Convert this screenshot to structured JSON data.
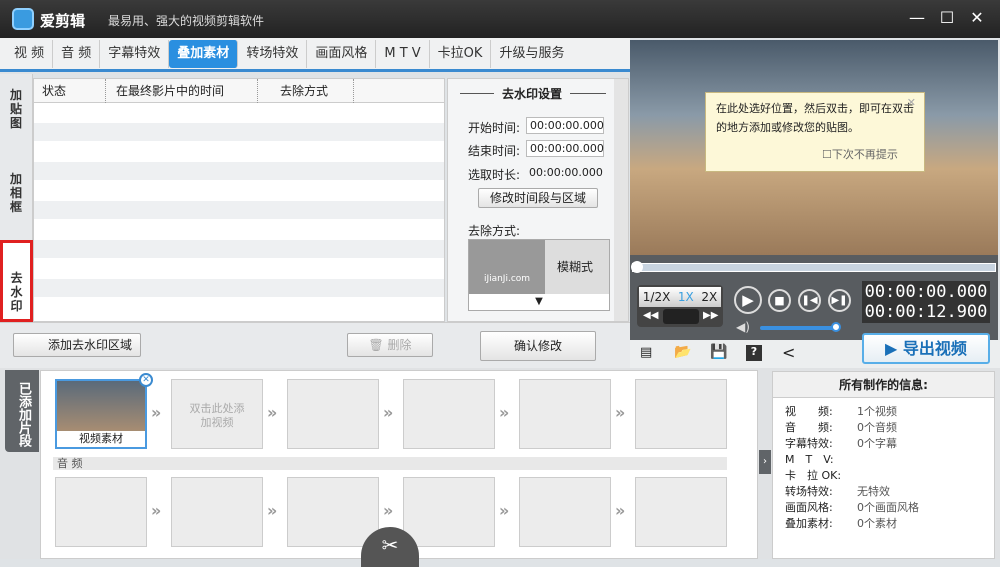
{
  "app": {
    "name": "爱剪辑",
    "slogan": "最易用、强大的视频剪辑软件",
    "minimize": "—",
    "maximize": "☐",
    "close": "✕"
  },
  "tabs": [
    "视 频",
    "音 频",
    "字幕特效",
    "叠加素材",
    "转场特效",
    "画面风格",
    "M T V",
    "卡拉OK",
    "升级与服务"
  ],
  "active_tab": "叠加素材",
  "side_tabs": [
    "加贴图",
    "加相框",
    "去水印"
  ],
  "table": {
    "headers": [
      "状态",
      "在最终影片中的时间",
      "去除方式"
    ]
  },
  "settings": {
    "title": "去水印设置",
    "start_label": "开始时间:",
    "start": "00:00:00.000",
    "end_label": "结束时间:",
    "end": "00:00:00.000",
    "dur_label": "选取时长:",
    "dur": "00:00:00.000",
    "modify_btn": "修改时间段与区域",
    "method_label": "去除方式:",
    "thumb_text": "iJianJi.com",
    "method": "模糊式",
    "dropdown": "▼"
  },
  "bottom": {
    "add_btn": "添加去水印区域",
    "delete_btn": "删除",
    "confirm_btn": "确认修改"
  },
  "tooltip": {
    "text": "在此处选好位置，然后双击，即可在双击的地方添加或修改您的贴图。",
    "checkbox": "下次不再提示",
    "close": "✕"
  },
  "player": {
    "speeds": [
      "1/2X",
      "1X",
      "2X"
    ],
    "active_speed": "1X",
    "time_current": "00:00:00.000",
    "time_total": "00:00:12.900",
    "volume": 1.0,
    "progress": 0.0
  },
  "export_btn": "导出视频",
  "clips_tab": "已添加片段",
  "timeline": {
    "clip_label": "视频素材",
    "placeholder": "双击此处添加视频",
    "audio_label": "音 频"
  },
  "info": {
    "title": "所有制作的信息:",
    "rows": [
      {
        "k": "视　　频:",
        "v": "1个视频"
      },
      {
        "k": "音　　频:",
        "v": "0个音频"
      },
      {
        "k": "字幕特效:",
        "v": "0个字幕"
      },
      {
        "k": "M　T　V:",
        "v": ""
      },
      {
        "k": "卡　拉 OK:",
        "v": ""
      },
      {
        "k": "转场特效:",
        "v": "无特效"
      },
      {
        "k": "画面风格:",
        "v": "0个画面风格"
      },
      {
        "k": "叠加素材:",
        "v": "0个素材"
      }
    ]
  }
}
